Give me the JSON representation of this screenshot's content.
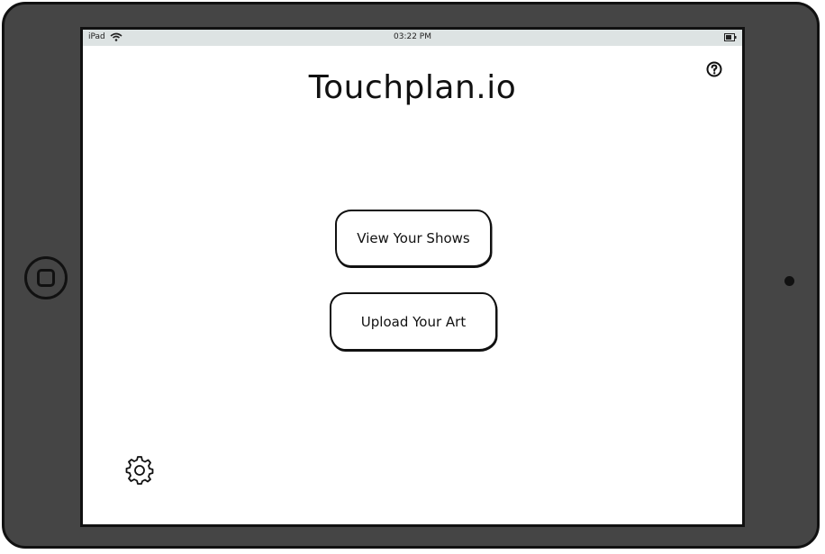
{
  "status_bar": {
    "device_label": "iPad",
    "time": "03:22 PM",
    "wifi_icon": "wifi-icon",
    "battery_icon": "battery-icon"
  },
  "app": {
    "title": "Touchplan.io"
  },
  "actions": {
    "view_shows_label": "View Your Shows",
    "upload_art_label": "Upload Your Art"
  },
  "icons": {
    "help": "help-icon",
    "settings": "gear-icon",
    "home": "home-button-icon"
  },
  "colors": {
    "device_frame": "#454545",
    "status_bar": "#dde3e3",
    "screen": "#ffffff",
    "ink": "#111111"
  }
}
